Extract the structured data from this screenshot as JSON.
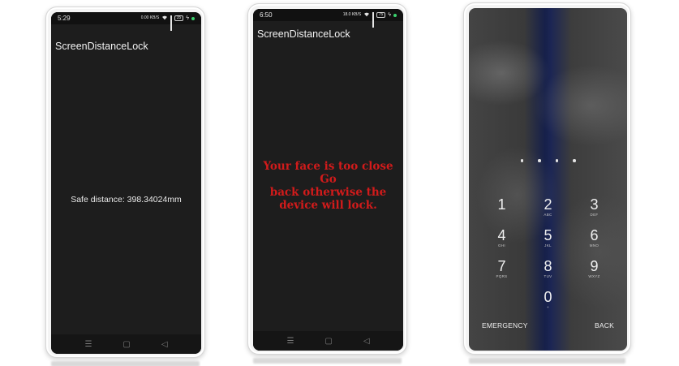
{
  "phone1": {
    "status_time": "5:29",
    "network_speed": "0.00 KB/S",
    "battery": "35",
    "app_title": "ScreenDistanceLock",
    "distance_text": "Safe distance: 398.34024mm"
  },
  "phone2": {
    "status_time": "6:50",
    "network_speed": "18.0 KB/S",
    "battery": "75",
    "app_title": "ScreenDistanceLock",
    "warning_line1": "Your face is too close Go",
    "warning_line2": "back otherwise the",
    "warning_line3": "device will lock.",
    "warning_color": "#d21b1b"
  },
  "lockscreen": {
    "keys": [
      {
        "digit": "1",
        "letters": ""
      },
      {
        "digit": "2",
        "letters": "ABC"
      },
      {
        "digit": "3",
        "letters": "DEF"
      },
      {
        "digit": "4",
        "letters": "GHI"
      },
      {
        "digit": "5",
        "letters": "JKL"
      },
      {
        "digit": "6",
        "letters": "MNO"
      },
      {
        "digit": "7",
        "letters": "PQRS"
      },
      {
        "digit": "8",
        "letters": "TUV"
      },
      {
        "digit": "9",
        "letters": "WXYZ"
      },
      {
        "digit": "0",
        "letters": "+"
      }
    ],
    "emergency_label": "EMERGENCY",
    "back_label": "BACK"
  },
  "navbar": {
    "menu_icon": "menu-icon",
    "home_icon": "home-icon",
    "back_icon": "back-icon",
    "menu_glyph": "☰",
    "home_glyph": "▢",
    "back_glyph": "◁"
  }
}
